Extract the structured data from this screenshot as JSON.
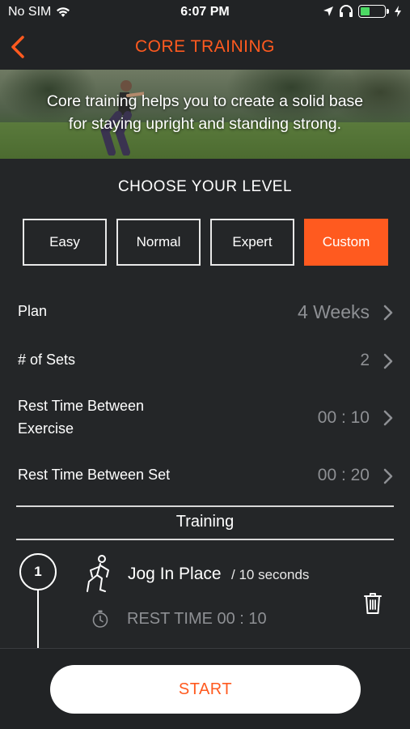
{
  "status_bar": {
    "carrier": "No SIM",
    "time": "6:07 PM",
    "icons": [
      "wifi-icon",
      "location-icon",
      "headphones-icon",
      "battery-icon",
      "charging-icon"
    ],
    "battery_level": 0.4
  },
  "nav": {
    "title": "CORE TRAINING",
    "back_icon": "chevron-left-icon"
  },
  "hero": {
    "text_line1": "Core training helps you to create a solid base",
    "text_line2": "for staying upright and standing strong."
  },
  "level": {
    "title": "CHOOSE YOUR LEVEL",
    "options": [
      "Easy",
      "Normal",
      "Expert",
      "Custom"
    ],
    "selected": "Custom"
  },
  "settings": {
    "plan": {
      "label": "Plan",
      "value": "4 Weeks"
    },
    "sets": {
      "label": "# of Sets",
      "value": "2"
    },
    "rest_exercise": {
      "label_line1": "Rest Time Between",
      "label_line2": "Exercise",
      "value": "00 : 10"
    },
    "rest_set": {
      "label": "Rest Time Between Set",
      "value": "00 : 20"
    }
  },
  "training": {
    "title": "Training",
    "exercises": [
      {
        "step": "1",
        "name": "Jog In Place",
        "duration": "/ 10 seconds",
        "rest": "REST TIME 00 : 10"
      }
    ]
  },
  "start_label": "START",
  "colors": {
    "accent": "#ff5a1f",
    "background": "#242628",
    "muted_text": "#8e9094"
  }
}
